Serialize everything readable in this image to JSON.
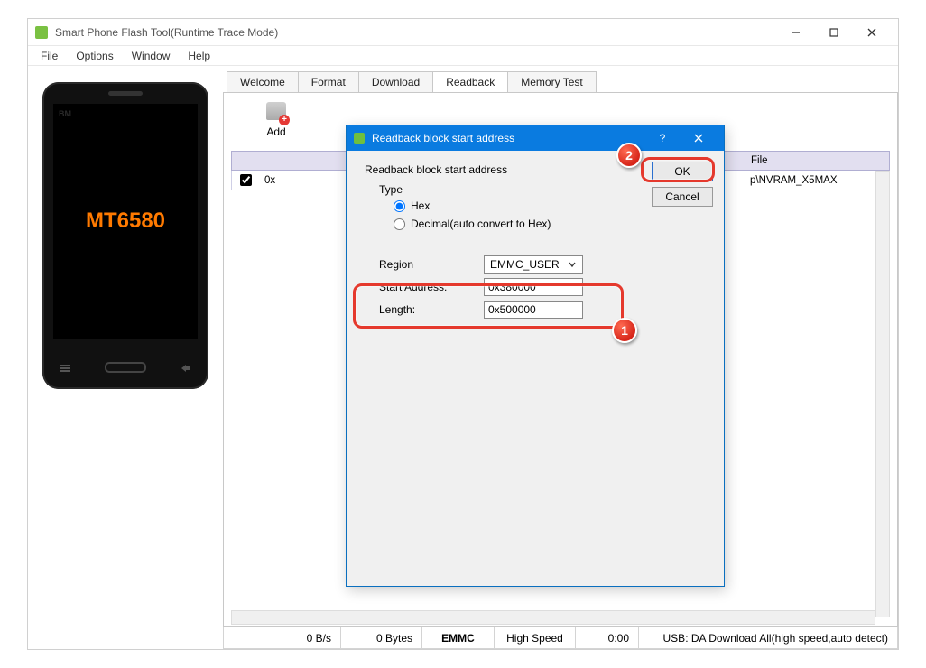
{
  "window": {
    "title": "Smart Phone Flash Tool(Runtime Trace Mode)"
  },
  "menu": {
    "file": "File",
    "options": "Options",
    "window": "Window",
    "help": "Help"
  },
  "phone": {
    "brand": "BM",
    "screen_text": "MT6580"
  },
  "tabs": {
    "welcome": "Welcome",
    "format": "Format",
    "download": "Download",
    "readback": "Readback",
    "memtest": "Memory Test",
    "active": "readback"
  },
  "toolbar": {
    "add_label": "Add"
  },
  "grid": {
    "head_file": "File",
    "row0_addr": "0x",
    "row0_file": "p\\NVRAM_X5MAX"
  },
  "status": {
    "rate": "0 B/s",
    "bytes": "0 Bytes",
    "storage": "EMMC",
    "speed": "High Speed",
    "time": "0:00",
    "usb": "USB: DA Download All(high speed,auto detect)"
  },
  "dialog": {
    "title": "Readback block start address",
    "section": "Readback block start address",
    "type_label": "Type",
    "type_hex": "Hex",
    "type_dec": "Decimal(auto convert to Hex)",
    "region_label": "Region",
    "region_value": "EMMC_USER",
    "start_label": "Start Address:",
    "start_value": "0x380000",
    "length_label": "Length:",
    "length_value": "0x500000",
    "ok": "OK",
    "cancel": "Cancel"
  },
  "callouts": {
    "one": "1",
    "two": "2"
  }
}
